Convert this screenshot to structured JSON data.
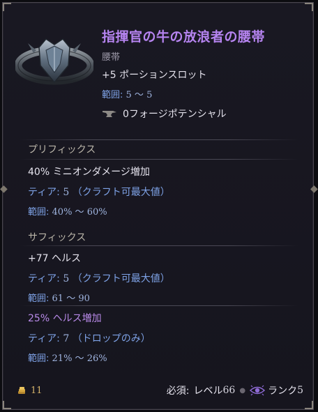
{
  "item": {
    "name": "指揮官の牛の放浪者の腰帯",
    "type": "腰帯",
    "implicit": "+5 ポーションスロット",
    "implicit_range_label": "範囲:",
    "implicit_range_value": "5 〜 5",
    "forge_potential": "0フォージポテンシャル"
  },
  "prefix": {
    "title": "プリフィックス",
    "affixes": [
      {
        "name": "40% ミニオンダメージ増加",
        "tier_label": "ティア:",
        "tier_value": "5",
        "tier_note": "（クラフト可最大値）",
        "range_label": "範囲:",
        "range_value": "40% 〜 60%"
      }
    ]
  },
  "suffix": {
    "title": "サフィックス",
    "affixes": [
      {
        "name": "+77 ヘルス",
        "tier_label": "ティア:",
        "tier_value": "5",
        "tier_note": "（クラフト可最大値）",
        "range_label": "範囲:",
        "range_value": "61 〜 90"
      },
      {
        "name": "25% ヘルス増加",
        "tier_label": "ティア:",
        "tier_value": "7",
        "tier_note": "（ドロップのみ）",
        "range_label": "範囲:",
        "range_value": "21% 〜 26%"
      }
    ]
  },
  "footer": {
    "gold_value": "11",
    "requirement_label": "必須:",
    "level_label": "レベル",
    "level_value": "66",
    "rank_label": "ランク",
    "rank_value": "5"
  },
  "colors": {
    "title": "#b684f0",
    "affix_blue": "#7ea2e6",
    "sealed_affix": "#b88ae8",
    "gold": "#d6b36a"
  },
  "icons": [
    "belt-item-image",
    "anvil-icon",
    "gold-coin-icon",
    "rank-eye-icon"
  ]
}
